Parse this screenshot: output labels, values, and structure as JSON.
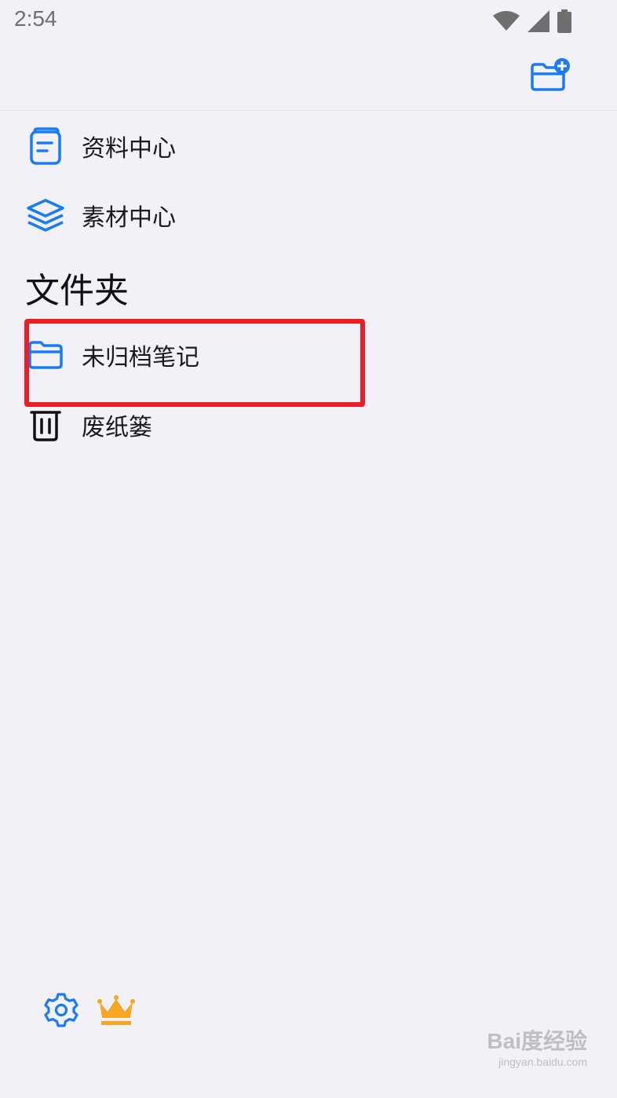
{
  "status_bar": {
    "time": "2:54",
    "icons": [
      "wifi-icon",
      "signal-icon",
      "battery-icon"
    ]
  },
  "header": {
    "new_folder_icon": "folder-add-icon",
    "accent_color": "#1a7cf0"
  },
  "nav": {
    "items": [
      {
        "icon": "document-icon",
        "label": "资料中心"
      },
      {
        "icon": "layers-icon",
        "label": "素材中心"
      }
    ]
  },
  "folders": {
    "title": "文件夹",
    "items": [
      {
        "icon": "folder-icon",
        "label": "未归档笔记",
        "highlighted": true
      },
      {
        "icon": "trash-icon",
        "label": "废纸篓"
      }
    ]
  },
  "footer": {
    "settings_icon": "gear-icon",
    "premium_icon": "crown-icon",
    "premium_color": "#f5a623"
  },
  "watermark": {
    "main": "Bai度经验",
    "sub": "jingyan.baidu.com"
  }
}
